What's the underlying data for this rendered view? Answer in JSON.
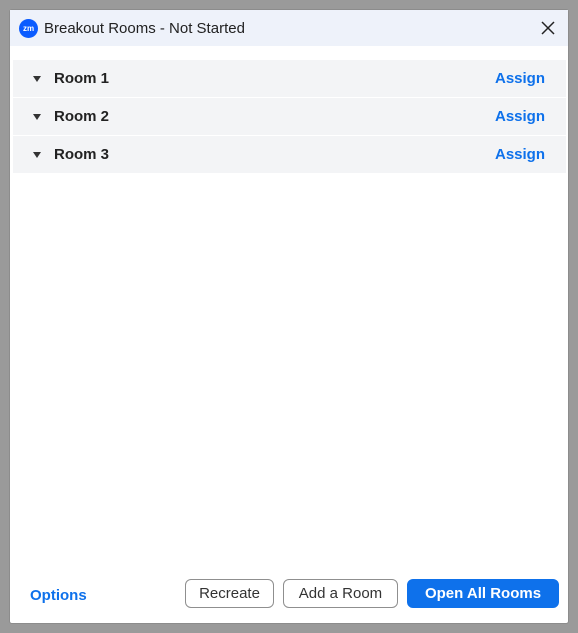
{
  "window": {
    "logo_text": "zm",
    "title": "Breakout Rooms - Not Started"
  },
  "rooms": [
    {
      "name": "Room 1",
      "action": "Assign"
    },
    {
      "name": "Room 2",
      "action": "Assign"
    },
    {
      "name": "Room 3",
      "action": "Assign"
    }
  ],
  "footer": {
    "options_label": "Options",
    "recreate_label": "Recreate",
    "add_room_label": "Add a Room",
    "open_all_label": "Open All Rooms"
  },
  "colors": {
    "accent": "#0e71eb",
    "logo": "#0b5cff",
    "titlebar": "#eef2fa",
    "row_bg": "#f3f4f6"
  },
  "icons": [
    "zoom-logo-icon",
    "close-icon",
    "caret-down-icon"
  ]
}
